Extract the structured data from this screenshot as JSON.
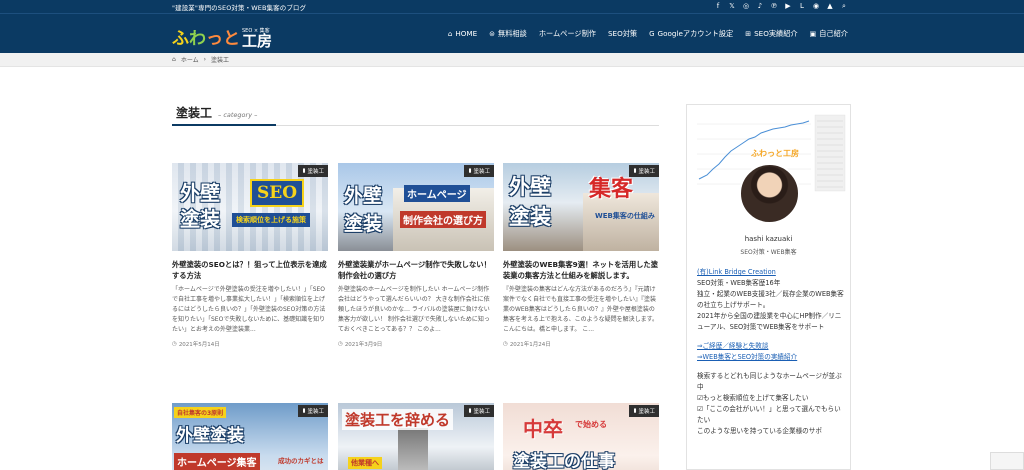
{
  "topbar": {
    "tagline": "\"建設業\"専門のSEO対策・WEB集客のブログ",
    "icons": [
      "facebook-icon",
      "x-icon",
      "instagram-icon",
      "tiktok-icon",
      "pinterest-icon",
      "youtube-icon",
      "line-icon",
      "rss-icon",
      "feedly-icon",
      "search-icon"
    ],
    "icon_glyphs": [
      "f",
      "𝕏",
      "◎",
      "♪",
      "℗",
      "▶",
      "L",
      "◉",
      "▲",
      "⌕"
    ]
  },
  "header": {
    "logo_part1": "ふ",
    "logo_part2": "わ",
    "logo_part3": "っと",
    "logo_small": "SEO × 集客",
    "logo_big": "工房",
    "nav": [
      {
        "icon": "⌂",
        "label": "HOME"
      },
      {
        "icon": "⊜",
        "label": "無料相談"
      },
      {
        "icon": "",
        "label": "ホームページ制作"
      },
      {
        "icon": "",
        "label": "SEO対策"
      },
      {
        "icon": "G",
        "label": "Googleアカウント設定"
      },
      {
        "icon": "⊞",
        "label": "SEO実績紹介"
      },
      {
        "icon": "▣",
        "label": "自己紹介"
      }
    ]
  },
  "breadcrumb": {
    "home": "ホーム",
    "sep": "›",
    "current": "塗装工"
  },
  "page": {
    "title": "塗装工",
    "sub": "– category –"
  },
  "badge_label": "塗装工",
  "cards": [
    {
      "title": "外壁塗装のSEOとは？！狙って上位表示を達成する方法",
      "excerpt": "「ホームページで外壁塗装の受注を増やしたい！」「SEOで自社工事を増やし事業拡大したい！」「検索順位を上げるにはどうしたら良いの？」「外壁塗装のSEO対策の方法を知りたい」「SEOで失敗しないために、基礎知識を知りたい」とお考えの外壁塗装業...",
      "date": "2021年5月14日",
      "thumb_big1": "外壁",
      "thumb_big2": "塗装",
      "thumb_seo": "SEO",
      "thumb_sub": "検索順位を上げる施策"
    },
    {
      "title": "外壁塗装業がホームページ制作で失敗しない！制作会社の選び方",
      "excerpt": "外壁塗装のホームページを制作したい ホームページ制作会社はどうやって選んだらいいの？ 大きな制作会社に依頼したほうが良いのかな… ライバルの塗装屋に負けない集客力が欲しい！ 制作会社選びで失敗しないために知っておくべきことってある？？ このよ...",
      "date": "2021年3月9日",
      "thumb_big1": "外壁",
      "thumb_big2": "塗装",
      "thumb_hp": "ホームページ",
      "thumb_sub": "制作会社の選び方"
    },
    {
      "title": "外壁塗装のWEB集客9選！ネットを活用した塗装業の集客方法と仕組みを解説します。",
      "excerpt": "『外壁塗装の集客はどんな方法があるのだろう』『元請け案件でなく自社でも直接工事の受注を増やしたい』『塗装業のWEB集客はどうしたら良いの？』外壁や屋根塗装の集客を考える上で抱える、このような疑問を解決します。 こんにちは。橋と申します。 こ...",
      "date": "2021年1月24日",
      "thumb_big1": "外壁",
      "thumb_big2": "塗装",
      "thumb_red": "集客",
      "thumb_sub": "WEB集客の仕組み"
    },
    {
      "thumb_tag": "自社集客の3原則",
      "thumb_big1": "外壁塗装",
      "thumb_hp": "ホームページ集客",
      "thumb_sub": "成功のカギとは"
    },
    {
      "thumb_big1": "塗装工を辞める",
      "thumb_sub": "他業種へ"
    },
    {
      "thumb_big1": "中卒",
      "thumb_small": "で始める",
      "thumb_sub": "塗装工の仕事"
    }
  ],
  "sidebar": {
    "name": "hashi kazuaki",
    "role": "SEO対策・WEB集客",
    "company_link": "(有)Link Bridge Creation",
    "lines": [
      "SEO対策・WEB集客歴16年",
      "独立・起業のWEB支援3社／既存企業のWEB集客の社立ち上げサポート。",
      "2021年から全国の建設業を中心にHP制作／リニューアル、SEO対策でWEB集客をサポート"
    ],
    "link1": "⇒ご経歴／経験と失敗談",
    "link2": "⇒WEB集客とSEO対策の実績紹介",
    "lines2": [
      "検索するとどれも同じようなホームページが並ぶ中",
      "☑もっと検索順位を上げて集客したい",
      "☑「ここの会社がいい！」と思って選んでもらいたい",
      "このような思いを持っている企業様のサポ"
    ]
  }
}
